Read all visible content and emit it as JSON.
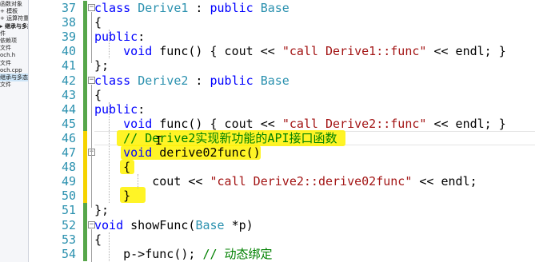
{
  "sidebar": {
    "items": [
      {
        "label": "函数对象",
        "selected": false,
        "bold": false
      },
      {
        "label": "+ 模板",
        "selected": false,
        "bold": false
      },
      {
        "label": "+ 运算符重载",
        "selected": false,
        "bold": false
      },
      {
        "label": "▸ 继承与多态",
        "selected": false,
        "bold": true
      },
      {
        "label": "件",
        "selected": false,
        "bold": false
      },
      {
        "label": "依赖项",
        "selected": false,
        "bold": false
      },
      {
        "label": "文件",
        "selected": false,
        "bold": false
      },
      {
        "label": "och.h",
        "selected": false,
        "bold": false
      },
      {
        "label": "文件",
        "selected": false,
        "bold": false
      },
      {
        "label": "och.cpp",
        "selected": false,
        "bold": false
      },
      {
        "label": "继承与多态",
        "selected": true,
        "bold": false
      },
      {
        "label": "文件",
        "selected": false,
        "bold": false
      }
    ]
  },
  "editor": {
    "lines": [
      {
        "num": "37",
        "tokens": [
          {
            "t": "kw",
            "v": "class "
          },
          {
            "t": "ty",
            "v": "Derive1"
          },
          {
            "t": "",
            "v": " : "
          },
          {
            "t": "kw",
            "v": "public "
          },
          {
            "t": "ty",
            "v": "Base"
          }
        ]
      },
      {
        "num": "38",
        "tokens": [
          {
            "t": "",
            "v": "{"
          }
        ]
      },
      {
        "num": "39",
        "tokens": [
          {
            "t": "kw",
            "v": "public"
          },
          {
            "t": "",
            "v": ":"
          }
        ]
      },
      {
        "num": "40",
        "tokens": [
          {
            "t": "",
            "v": "    "
          },
          {
            "t": "kw",
            "v": "void "
          },
          {
            "t": "",
            "v": "func() { cout << "
          },
          {
            "t": "str",
            "v": "\"call Derive1::func\""
          },
          {
            "t": "",
            "v": " << endl; }"
          }
        ]
      },
      {
        "num": "41",
        "tokens": [
          {
            "t": "",
            "v": "};"
          }
        ]
      },
      {
        "num": "42",
        "tokens": [
          {
            "t": "kw",
            "v": "class "
          },
          {
            "t": "ty",
            "v": "Derive2"
          },
          {
            "t": "",
            "v": " : "
          },
          {
            "t": "kw",
            "v": "public "
          },
          {
            "t": "ty",
            "v": "Base"
          }
        ]
      },
      {
        "num": "43",
        "tokens": [
          {
            "t": "",
            "v": "{"
          }
        ]
      },
      {
        "num": "44",
        "tokens": [
          {
            "t": "kw",
            "v": "public"
          },
          {
            "t": "",
            "v": ":"
          }
        ]
      },
      {
        "num": "45",
        "tokens": [
          {
            "t": "",
            "v": "    "
          },
          {
            "t": "kw",
            "v": "void "
          },
          {
            "t": "",
            "v": "func() { cout << "
          },
          {
            "t": "str",
            "v": "\"call Derive2::func\""
          },
          {
            "t": "",
            "v": " << endl; }"
          }
        ]
      },
      {
        "num": "46",
        "tokens": [
          {
            "t": "",
            "v": "    "
          },
          {
            "t": "cmt",
            "v": "// Derive2实现新功能的API接口函数"
          }
        ]
      },
      {
        "num": "47",
        "tokens": [
          {
            "t": "",
            "v": "    "
          },
          {
            "t": "kw",
            "v": "void "
          },
          {
            "t": "",
            "v": "derive02func()"
          }
        ]
      },
      {
        "num": "48",
        "tokens": [
          {
            "t": "",
            "v": "    {"
          }
        ]
      },
      {
        "num": "49",
        "tokens": [
          {
            "t": "",
            "v": "        cout << "
          },
          {
            "t": "str",
            "v": "\"call Derive2::derive02func\""
          },
          {
            "t": "",
            "v": " << endl;"
          }
        ]
      },
      {
        "num": "50",
        "tokens": [
          {
            "t": "",
            "v": "    }"
          }
        ]
      },
      {
        "num": "51",
        "tokens": [
          {
            "t": "",
            "v": "};"
          }
        ]
      },
      {
        "num": "52",
        "tokens": [
          {
            "t": "kw",
            "v": "void "
          },
          {
            "t": "",
            "v": "showFunc("
          },
          {
            "t": "ty",
            "v": "Base"
          },
          {
            "t": "",
            "v": " *p)"
          }
        ]
      },
      {
        "num": "53",
        "tokens": [
          {
            "t": "",
            "v": "{"
          }
        ]
      },
      {
        "num": "54",
        "tokens": [
          {
            "t": "",
            "v": "    p->func(); "
          },
          {
            "t": "cmt",
            "v": "// 动态绑定"
          }
        ]
      }
    ]
  },
  "colors": {
    "keyword": "#0000ff",
    "type": "#2b91af",
    "string": "#a31515",
    "comment": "#008000",
    "line_number": "#2b91af",
    "change_saved": "#57a64a",
    "change_unsaved": "#f5d300",
    "highlighter": "#fff200"
  },
  "icons": {
    "fold_collapse": "minus-box-icon",
    "text_cursor": "i-beam-icon"
  }
}
